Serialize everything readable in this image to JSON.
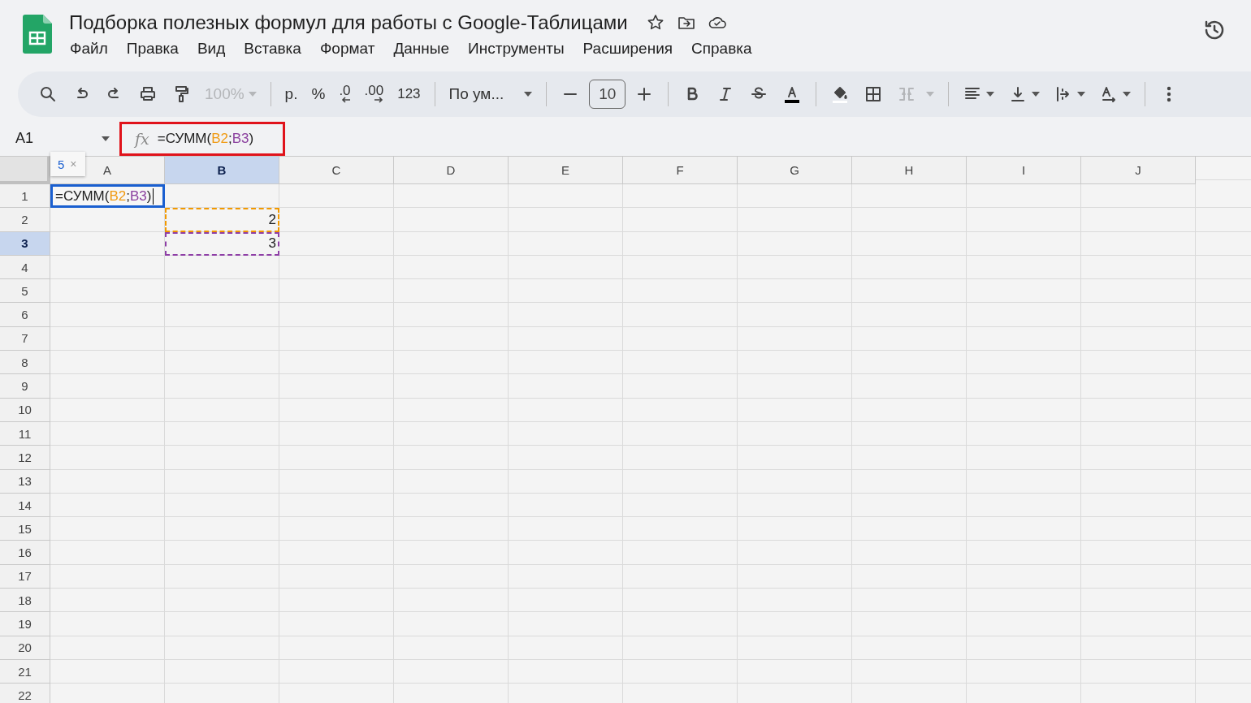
{
  "document": {
    "title": "Подборка полезных формул для работы с Google-Таблицами"
  },
  "menu": [
    "Файл",
    "Правка",
    "Вид",
    "Вставка",
    "Формат",
    "Данные",
    "Инструменты",
    "Расширения",
    "Справка"
  ],
  "toolbar": {
    "zoom": {
      "label": "100%",
      "disabled": true
    },
    "currency": "р.",
    "percent": "%",
    "decrease_decimals": ".0",
    "increase_decimals": ".00",
    "number_format": "123",
    "font": "По ум...",
    "font_size": "10",
    "merge_disabled": true
  },
  "formula_bar": {
    "name_box": "A1",
    "function_label": "fx",
    "highlighted": true,
    "parts": [
      {
        "kind": "text",
        "text": "=СУММ("
      },
      {
        "kind": "ref",
        "text": "B2",
        "color": "#f09a12"
      },
      {
        "kind": "text",
        "text": ";"
      },
      {
        "kind": "ref",
        "text": "B3",
        "color": "#8a3f9e"
      },
      {
        "kind": "text",
        "text": ")"
      }
    ]
  },
  "tooltip": {
    "value": "5",
    "close": "×"
  },
  "grid": {
    "columns": [
      {
        "label": "A",
        "selected": false
      },
      {
        "label": "B",
        "selected": true
      },
      {
        "label": "C",
        "selected": false
      },
      {
        "label": "D",
        "selected": false
      },
      {
        "label": "E",
        "selected": false
      },
      {
        "label": "F",
        "selected": false
      },
      {
        "label": "G",
        "selected": false
      },
      {
        "label": "H",
        "selected": false
      },
      {
        "label": "I",
        "selected": false
      },
      {
        "label": "J",
        "selected": false
      }
    ],
    "rows": [
      {
        "label": "1",
        "selected": false,
        "cells": [
          {
            "kind": "editing",
            "parts": [
              {
                "kind": "text",
                "text": "=СУММ("
              },
              {
                "kind": "ref",
                "text": "B2",
                "color": "#f09a12"
              },
              {
                "kind": "text",
                "text": ";"
              },
              {
                "kind": "ref",
                "text": "B3",
                "color": "#8a3f9e"
              },
              {
                "kind": "text",
                "text": ")"
              }
            ]
          }
        ]
      },
      {
        "label": "2",
        "selected": false,
        "cells": [
          null,
          {
            "kind": "value",
            "value": "2",
            "color": "#f29900"
          }
        ]
      },
      {
        "label": "3",
        "selected": true,
        "cells": [
          null,
          {
            "kind": "value",
            "value": "3",
            "color": "#8e3fa6"
          }
        ]
      },
      {
        "label": "4",
        "selected": false
      },
      {
        "label": "5",
        "selected": false
      },
      {
        "label": "6",
        "selected": false
      },
      {
        "label": "7",
        "selected": false
      },
      {
        "label": "8",
        "selected": false
      },
      {
        "label": "9",
        "selected": false
      },
      {
        "label": "10",
        "selected": false
      },
      {
        "label": "11",
        "selected": false
      },
      {
        "label": "12",
        "selected": false
      },
      {
        "label": "13",
        "selected": false
      },
      {
        "label": "14",
        "selected": false
      },
      {
        "label": "15",
        "selected": false
      },
      {
        "label": "16",
        "selected": false
      },
      {
        "label": "17",
        "selected": false
      },
      {
        "label": "18",
        "selected": false
      },
      {
        "label": "19",
        "selected": false
      },
      {
        "label": "20",
        "selected": false
      },
      {
        "label": "21",
        "selected": false
      },
      {
        "label": "22",
        "selected": false
      }
    ]
  }
}
